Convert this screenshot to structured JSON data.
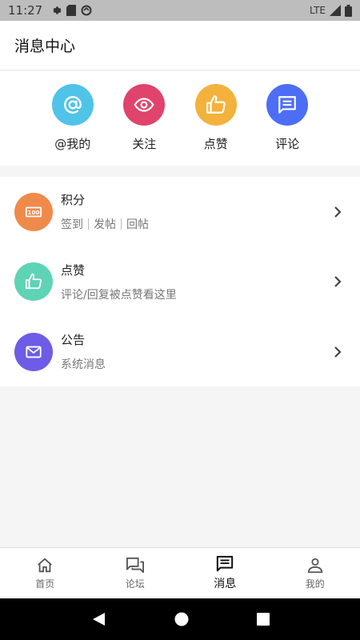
{
  "status_bar": {
    "time": "11:27",
    "network": "LTE"
  },
  "header": {
    "title": "消息中心"
  },
  "quick_actions": [
    {
      "label": "@我的",
      "icon": "at-icon",
      "color": "#4fc3e8"
    },
    {
      "label": "关注",
      "icon": "eye-icon",
      "color": "#e0436c"
    },
    {
      "label": "点赞",
      "icon": "thumbs-up-icon",
      "color": "#f3b23c"
    },
    {
      "label": "评论",
      "icon": "comment-icon",
      "color": "#4c6ef5"
    }
  ],
  "list": [
    {
      "title": "积分",
      "sub": [
        "签到",
        "发帖",
        "回帖"
      ],
      "icon": "points-icon",
      "color": "#f08a4b"
    },
    {
      "title": "点赞",
      "sub_text": "评论/回复被点赞看这里",
      "icon": "thumbs-up-icon",
      "color": "#5ed3b5"
    },
    {
      "title": "公告",
      "sub_text": "系统消息",
      "icon": "mail-icon",
      "color": "#6c5ce7"
    }
  ],
  "tabs": [
    {
      "label": "首页",
      "icon": "home-icon"
    },
    {
      "label": "论坛",
      "icon": "forum-icon"
    },
    {
      "label": "消息",
      "icon": "message-icon",
      "active": true
    },
    {
      "label": "我的",
      "icon": "profile-icon"
    }
  ]
}
